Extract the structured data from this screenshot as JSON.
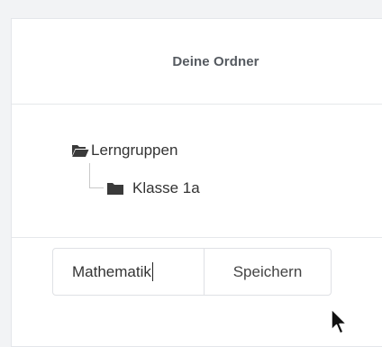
{
  "header": {
    "title": "Deine Ordner"
  },
  "tree": {
    "root": {
      "label": "Lerngruppen",
      "icon": "folder-open-icon"
    },
    "children": [
      {
        "label": "Klasse 1a",
        "icon": "folder-icon"
      }
    ]
  },
  "form": {
    "input_value": "Mathematik",
    "save_label": "Speichern"
  },
  "colors": {
    "icon": "#3a3a3a",
    "border": "#dfe1e5",
    "title": "#555a60",
    "background": "#f2f3f5"
  },
  "pointer": {
    "icon": "mouse-pointer-icon"
  }
}
